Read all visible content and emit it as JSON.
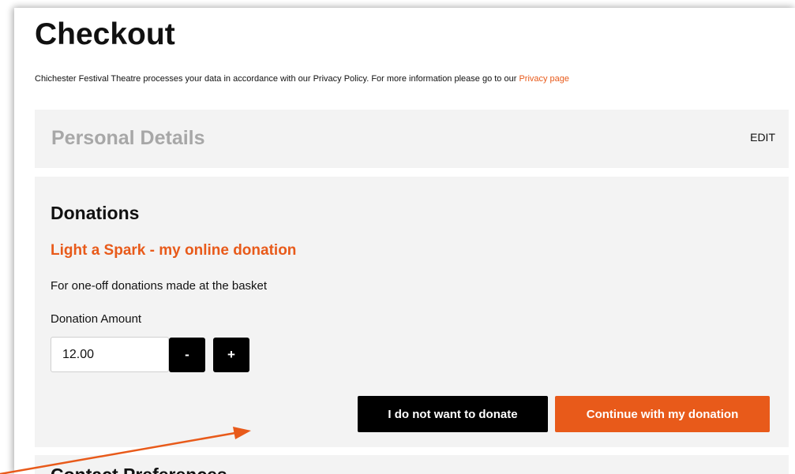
{
  "page": {
    "title": "Checkout"
  },
  "privacy": {
    "text": "Chichester Festival Theatre processes your data in accordance with our Privacy Policy. For more information please go to our ",
    "link_label": "Privacy page"
  },
  "personal_details": {
    "heading": "Personal Details",
    "edit_label": "EDIT"
  },
  "donations": {
    "heading": "Donations",
    "fund_title": "Light a Spark - my online donation",
    "description": "For one-off donations made at the basket",
    "amount_label": "Donation Amount",
    "amount_value": "12.00",
    "decrement_label": "-",
    "increment_label": "+",
    "decline_label": "I do not want to donate",
    "continue_label": "Continue with my donation"
  },
  "contact_preferences": {
    "heading": "Contact Preferences"
  },
  "colors": {
    "accent": "#e85a1a",
    "annotation_arrow": "#e85a1a",
    "panel_background": "#f3f3f3",
    "button_dark": "#000000"
  }
}
